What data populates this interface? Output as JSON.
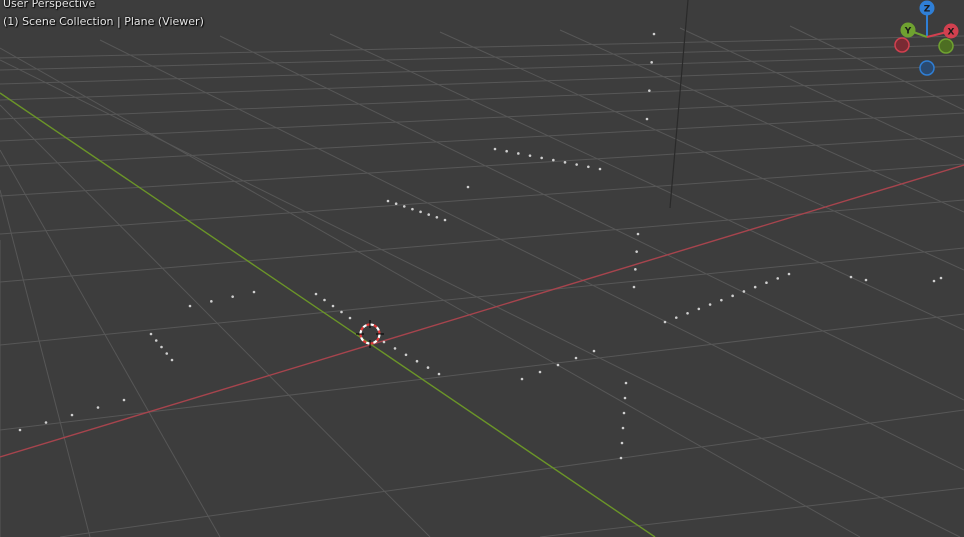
{
  "viewport": {
    "title": "User Perspective",
    "info": "(1) Scene Collection | Plane (Viewer)",
    "background_color": "#3d3d3d",
    "grid_color": "#575757",
    "x_axis_color": "#a6444d",
    "y_axis_color": "#6b9528",
    "vertex_color": "#cfcfcf"
  },
  "navigation_gizmo": {
    "axes": [
      {
        "name": "z",
        "label": "Z",
        "color": "#2f7fd6"
      },
      {
        "name": "y",
        "label": "Y",
        "color": "#6fa230"
      },
      {
        "name": "x",
        "label": "X",
        "color": "#d2404f"
      },
      {
        "name": "neg-x",
        "label": "",
        "color": "#d2404f"
      },
      {
        "name": "neg-y",
        "label": "",
        "color": "#6fa230"
      },
      {
        "name": "neg-z",
        "label": "",
        "color": "#2f7fd6"
      }
    ]
  },
  "cursor": {
    "name": "3d-cursor",
    "ring_colors": [
      "#ffffff",
      "#e23a3a"
    ]
  }
}
